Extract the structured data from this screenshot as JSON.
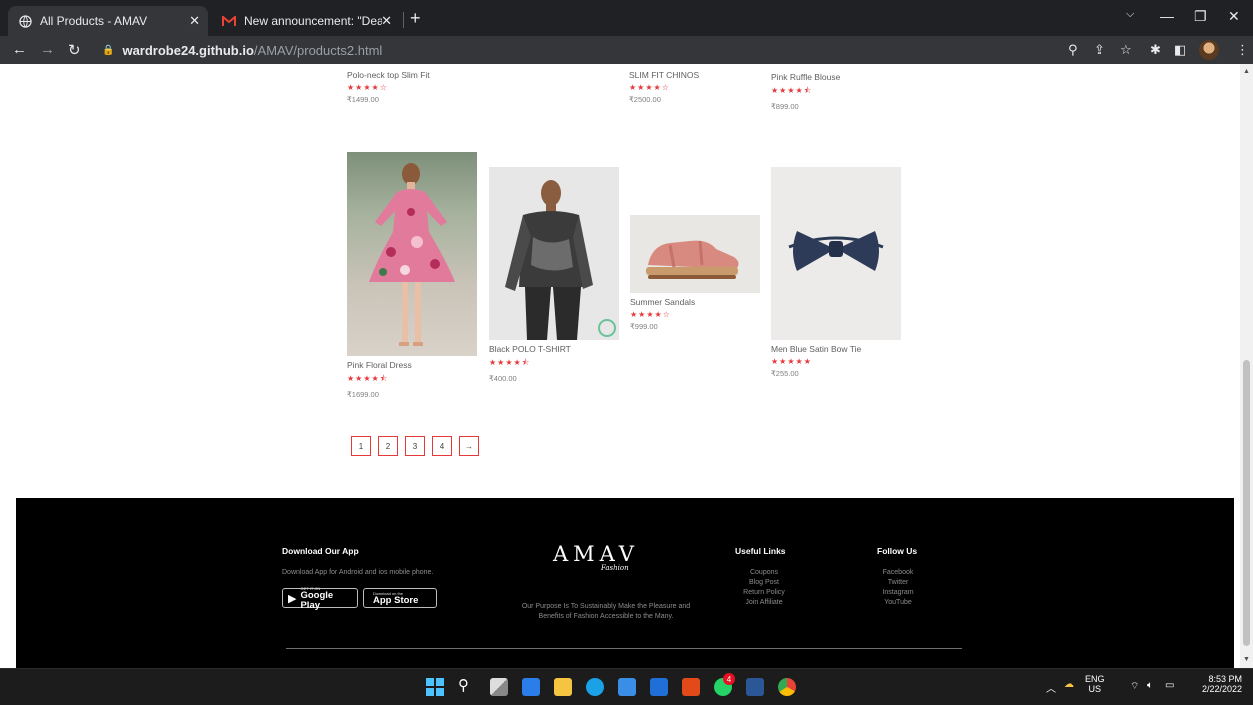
{
  "browser": {
    "tabs": [
      {
        "title": "All Products - AMAV",
        "active": true
      },
      {
        "title": "New announcement: \"Dear stude",
        "active": false
      }
    ],
    "url_host": "wardrobe24.github.io",
    "url_path": "/AMAV/products2.html"
  },
  "top_row": [
    {
      "name": "Polo-neck top Slim Fit",
      "stars": "★★★★☆",
      "price": "₹1499.00"
    },
    {
      "name": "SLIM FIT CHINOS",
      "stars": "★★★★☆",
      "price": "₹2500.00"
    },
    {
      "name": "Pink Ruffle Blouse",
      "stars": "★★★★⯪",
      "price": "₹899.00"
    }
  ],
  "products": [
    {
      "name": "Pink Floral Dress",
      "stars": "★★★★⯪",
      "price": "₹1699.00"
    },
    {
      "name": "Black POLO T-SHIRT",
      "stars": "★★★★⯪",
      "price": "₹400.00"
    },
    {
      "name": "Summer Sandals",
      "stars": "★★★★☆",
      "price": "₹999.00"
    },
    {
      "name": "Men Blue Satin Bow Tie",
      "stars": "★★★★★",
      "price": "₹255.00"
    }
  ],
  "pagination": {
    "pages": [
      "1",
      "2",
      "3",
      "4"
    ],
    "next": "→"
  },
  "footer": {
    "download_heading": "Download Our App",
    "download_text": "Download App for Android and ios mobile phone.",
    "google_play_small": "GET IT ON",
    "google_play_big": "Google Play",
    "app_store_small": "Download on the",
    "app_store_big": "App Store",
    "logo": "AMAV",
    "logo_sub": "Fashion",
    "purpose_line1": "Our Purpose Is To Sustainably Make the Pleasure and",
    "purpose_line2": "Benefits of Fashion Accessible to the Many.",
    "useful_heading": "Useful Links",
    "useful_links": [
      "Coupons",
      "Blog Post",
      "Return Policy",
      "Join Affiliate"
    ],
    "follow_heading": "Follow Us",
    "follow_links": [
      "Facebook",
      "Twitter",
      "Instagram",
      "YouTube"
    ]
  },
  "taskbar": {
    "lang1": "ENG",
    "lang2": "US",
    "time": "8:53 PM",
    "date": "2/22/2022",
    "whatsapp_badge": "4"
  },
  "colors": {
    "accent": "#e5383b",
    "footer_bg": "#000000",
    "chrome": "#35363a"
  }
}
